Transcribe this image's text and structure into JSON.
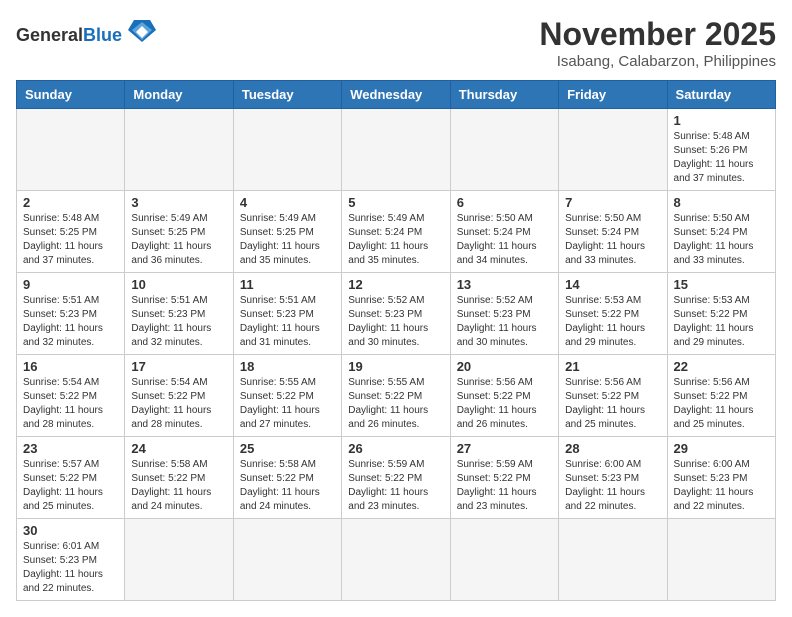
{
  "header": {
    "logo_general": "General",
    "logo_blue": "Blue",
    "month_title": "November 2025",
    "location": "Isabang, Calabarzon, Philippines"
  },
  "weekdays": [
    "Sunday",
    "Monday",
    "Tuesday",
    "Wednesday",
    "Thursday",
    "Friday",
    "Saturday"
  ],
  "weeks": [
    [
      {
        "day": "",
        "sunrise": "",
        "sunset": "",
        "daylight": "",
        "empty": true
      },
      {
        "day": "",
        "sunrise": "",
        "sunset": "",
        "daylight": "",
        "empty": true
      },
      {
        "day": "",
        "sunrise": "",
        "sunset": "",
        "daylight": "",
        "empty": true
      },
      {
        "day": "",
        "sunrise": "",
        "sunset": "",
        "daylight": "",
        "empty": true
      },
      {
        "day": "",
        "sunrise": "",
        "sunset": "",
        "daylight": "",
        "empty": true
      },
      {
        "day": "",
        "sunrise": "",
        "sunset": "",
        "daylight": "",
        "empty": true
      },
      {
        "day": "1",
        "sunrise": "Sunrise: 5:48 AM",
        "sunset": "Sunset: 5:26 PM",
        "daylight": "Daylight: 11 hours and 37 minutes.",
        "empty": false
      }
    ],
    [
      {
        "day": "2",
        "sunrise": "Sunrise: 5:48 AM",
        "sunset": "Sunset: 5:25 PM",
        "daylight": "Daylight: 11 hours and 37 minutes.",
        "empty": false
      },
      {
        "day": "3",
        "sunrise": "Sunrise: 5:49 AM",
        "sunset": "Sunset: 5:25 PM",
        "daylight": "Daylight: 11 hours and 36 minutes.",
        "empty": false
      },
      {
        "day": "4",
        "sunrise": "Sunrise: 5:49 AM",
        "sunset": "Sunset: 5:25 PM",
        "daylight": "Daylight: 11 hours and 35 minutes.",
        "empty": false
      },
      {
        "day": "5",
        "sunrise": "Sunrise: 5:49 AM",
        "sunset": "Sunset: 5:24 PM",
        "daylight": "Daylight: 11 hours and 35 minutes.",
        "empty": false
      },
      {
        "day": "6",
        "sunrise": "Sunrise: 5:50 AM",
        "sunset": "Sunset: 5:24 PM",
        "daylight": "Daylight: 11 hours and 34 minutes.",
        "empty": false
      },
      {
        "day": "7",
        "sunrise": "Sunrise: 5:50 AM",
        "sunset": "Sunset: 5:24 PM",
        "daylight": "Daylight: 11 hours and 33 minutes.",
        "empty": false
      },
      {
        "day": "8",
        "sunrise": "Sunrise: 5:50 AM",
        "sunset": "Sunset: 5:24 PM",
        "daylight": "Daylight: 11 hours and 33 minutes.",
        "empty": false
      }
    ],
    [
      {
        "day": "9",
        "sunrise": "Sunrise: 5:51 AM",
        "sunset": "Sunset: 5:23 PM",
        "daylight": "Daylight: 11 hours and 32 minutes.",
        "empty": false
      },
      {
        "day": "10",
        "sunrise": "Sunrise: 5:51 AM",
        "sunset": "Sunset: 5:23 PM",
        "daylight": "Daylight: 11 hours and 32 minutes.",
        "empty": false
      },
      {
        "day": "11",
        "sunrise": "Sunrise: 5:51 AM",
        "sunset": "Sunset: 5:23 PM",
        "daylight": "Daylight: 11 hours and 31 minutes.",
        "empty": false
      },
      {
        "day": "12",
        "sunrise": "Sunrise: 5:52 AM",
        "sunset": "Sunset: 5:23 PM",
        "daylight": "Daylight: 11 hours and 30 minutes.",
        "empty": false
      },
      {
        "day": "13",
        "sunrise": "Sunrise: 5:52 AM",
        "sunset": "Sunset: 5:23 PM",
        "daylight": "Daylight: 11 hours and 30 minutes.",
        "empty": false
      },
      {
        "day": "14",
        "sunrise": "Sunrise: 5:53 AM",
        "sunset": "Sunset: 5:22 PM",
        "daylight": "Daylight: 11 hours and 29 minutes.",
        "empty": false
      },
      {
        "day": "15",
        "sunrise": "Sunrise: 5:53 AM",
        "sunset": "Sunset: 5:22 PM",
        "daylight": "Daylight: 11 hours and 29 minutes.",
        "empty": false
      }
    ],
    [
      {
        "day": "16",
        "sunrise": "Sunrise: 5:54 AM",
        "sunset": "Sunset: 5:22 PM",
        "daylight": "Daylight: 11 hours and 28 minutes.",
        "empty": false
      },
      {
        "day": "17",
        "sunrise": "Sunrise: 5:54 AM",
        "sunset": "Sunset: 5:22 PM",
        "daylight": "Daylight: 11 hours and 28 minutes.",
        "empty": false
      },
      {
        "day": "18",
        "sunrise": "Sunrise: 5:55 AM",
        "sunset": "Sunset: 5:22 PM",
        "daylight": "Daylight: 11 hours and 27 minutes.",
        "empty": false
      },
      {
        "day": "19",
        "sunrise": "Sunrise: 5:55 AM",
        "sunset": "Sunset: 5:22 PM",
        "daylight": "Daylight: 11 hours and 26 minutes.",
        "empty": false
      },
      {
        "day": "20",
        "sunrise": "Sunrise: 5:56 AM",
        "sunset": "Sunset: 5:22 PM",
        "daylight": "Daylight: 11 hours and 26 minutes.",
        "empty": false
      },
      {
        "day": "21",
        "sunrise": "Sunrise: 5:56 AM",
        "sunset": "Sunset: 5:22 PM",
        "daylight": "Daylight: 11 hours and 25 minutes.",
        "empty": false
      },
      {
        "day": "22",
        "sunrise": "Sunrise: 5:56 AM",
        "sunset": "Sunset: 5:22 PM",
        "daylight": "Daylight: 11 hours and 25 minutes.",
        "empty": false
      }
    ],
    [
      {
        "day": "23",
        "sunrise": "Sunrise: 5:57 AM",
        "sunset": "Sunset: 5:22 PM",
        "daylight": "Daylight: 11 hours and 25 minutes.",
        "empty": false
      },
      {
        "day": "24",
        "sunrise": "Sunrise: 5:58 AM",
        "sunset": "Sunset: 5:22 PM",
        "daylight": "Daylight: 11 hours and 24 minutes.",
        "empty": false
      },
      {
        "day": "25",
        "sunrise": "Sunrise: 5:58 AM",
        "sunset": "Sunset: 5:22 PM",
        "daylight": "Daylight: 11 hours and 24 minutes.",
        "empty": false
      },
      {
        "day": "26",
        "sunrise": "Sunrise: 5:59 AM",
        "sunset": "Sunset: 5:22 PM",
        "daylight": "Daylight: 11 hours and 23 minutes.",
        "empty": false
      },
      {
        "day": "27",
        "sunrise": "Sunrise: 5:59 AM",
        "sunset": "Sunset: 5:22 PM",
        "daylight": "Daylight: 11 hours and 23 minutes.",
        "empty": false
      },
      {
        "day": "28",
        "sunrise": "Sunrise: 6:00 AM",
        "sunset": "Sunset: 5:23 PM",
        "daylight": "Daylight: 11 hours and 22 minutes.",
        "empty": false
      },
      {
        "day": "29",
        "sunrise": "Sunrise: 6:00 AM",
        "sunset": "Sunset: 5:23 PM",
        "daylight": "Daylight: 11 hours and 22 minutes.",
        "empty": false
      }
    ],
    [
      {
        "day": "30",
        "sunrise": "Sunrise: 6:01 AM",
        "sunset": "Sunset: 5:23 PM",
        "daylight": "Daylight: 11 hours and 22 minutes.",
        "empty": false
      },
      {
        "day": "",
        "sunrise": "",
        "sunset": "",
        "daylight": "",
        "empty": true
      },
      {
        "day": "",
        "sunrise": "",
        "sunset": "",
        "daylight": "",
        "empty": true
      },
      {
        "day": "",
        "sunrise": "",
        "sunset": "",
        "daylight": "",
        "empty": true
      },
      {
        "day": "",
        "sunrise": "",
        "sunset": "",
        "daylight": "",
        "empty": true
      },
      {
        "day": "",
        "sunrise": "",
        "sunset": "",
        "daylight": "",
        "empty": true
      },
      {
        "day": "",
        "sunrise": "",
        "sunset": "",
        "daylight": "",
        "empty": true
      }
    ]
  ]
}
